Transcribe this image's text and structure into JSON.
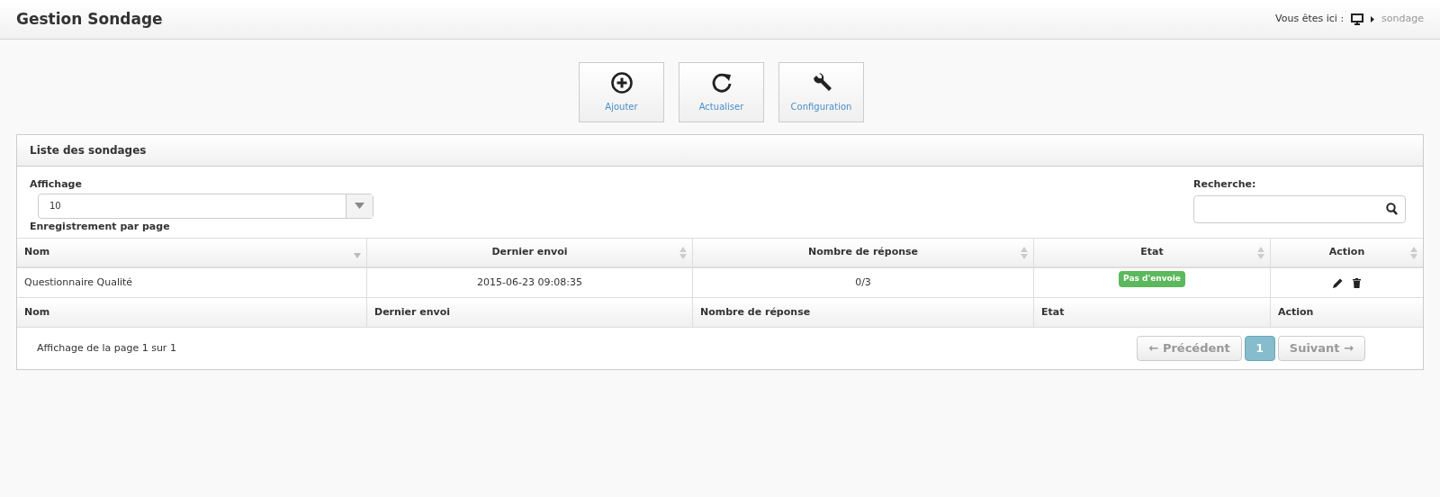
{
  "header": {
    "title": "Gestion Sondage",
    "breadcrumb_label": "Vous êtes ici :",
    "breadcrumb_current": "sondage"
  },
  "toolbar": [
    {
      "kind": "add",
      "label": "Ajouter"
    },
    {
      "kind": "refresh",
      "label": "Actualiser"
    },
    {
      "kind": "config",
      "label": "Configuration"
    }
  ],
  "panel": {
    "title": "Liste des sondages",
    "length": {
      "label": "Affichage",
      "value": "10",
      "hint": "Enregistrement par page"
    },
    "search": {
      "label": "Recherche:"
    },
    "table": {
      "columns": [
        {
          "label": "Nom",
          "kind": "sorted"
        },
        {
          "label": "Dernier envoi",
          "kind": "sortable"
        },
        {
          "label": "Nombre de réponse",
          "kind": "sortable"
        },
        {
          "label": "Etat",
          "kind": "sortable"
        },
        {
          "label": "Action",
          "kind": "sortable"
        }
      ],
      "rows": [
        {
          "name": "Questionnaire Qualité",
          "last_sent": "2015-06-23 09:08:35",
          "responses": "0/3",
          "status": "Pas d'envoie",
          "color": "#5cb85c"
        }
      ],
      "footer": [
        "Nom",
        "Dernier envoi",
        "Nombre de réponse",
        "Etat",
        "Action"
      ]
    },
    "info": "Affichage de la page 1 sur 1",
    "pagination": {
      "previous": {
        "label": "← Précédent",
        "disabled": true
      },
      "pages": [
        {
          "label": "1",
          "selected": true
        }
      ],
      "next": {
        "label": "Suivant →",
        "disabled": true
      }
    }
  }
}
